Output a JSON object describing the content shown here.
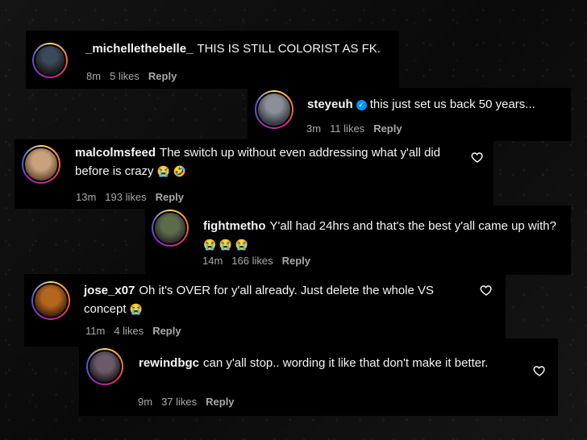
{
  "comments": [
    {
      "username": "_michellethebelle_",
      "text": "THIS IS STILL COLORIST AS FK.",
      "time": "8m",
      "likes": "5 likes",
      "reply": "Reply",
      "avatar_colors": [
        "#3a4a5a",
        "#1b1b1b"
      ]
    },
    {
      "username": "steyeuh",
      "verified": true,
      "text": "this just set us back 50 years...",
      "time": "3m",
      "likes": "11 likes",
      "reply": "Reply",
      "avatar_colors": [
        "#8a8f98",
        "#3b3f45"
      ]
    },
    {
      "username": "malcolmsfeed",
      "text": "The switch up without even addressing what y'all did before is crazy",
      "emojis": "😭 🤣",
      "time": "13m",
      "likes": "193 likes",
      "reply": "Reply",
      "avatar_colors": [
        "#c7a27c",
        "#6b4a32"
      ]
    },
    {
      "username": "fightmetho",
      "text": "Y'all had 24hrs and that's the best y'all came up with?",
      "emojis": "😭 😭 😭",
      "time": "14m",
      "likes": "166 likes",
      "reply": "Reply",
      "avatar_colors": [
        "#5c6b4a",
        "#2a2a2a"
      ]
    },
    {
      "username": "jose_x07",
      "text": "Oh it's OVER for y'all already. Just delete the whole VS concept",
      "emojis": "😭",
      "time": "11m",
      "likes": "4 likes",
      "reply": "Reply",
      "avatar_colors": [
        "#b5651d",
        "#3d2210"
      ]
    },
    {
      "username": "rewindbgc",
      "text": "can y'all stop.. wording it like that don't make it better.",
      "time": "9m",
      "likes": "37 likes",
      "reply": "Reply",
      "avatar_colors": [
        "#6a5a6a",
        "#1e1a1e"
      ]
    }
  ],
  "icons": {
    "like": "heart-outline-icon",
    "verified": "verified-badge-icon"
  },
  "accent_colors": {
    "verified": "#0095f6",
    "meta_text": "#a8a8a8",
    "card_bg": "#000000"
  }
}
